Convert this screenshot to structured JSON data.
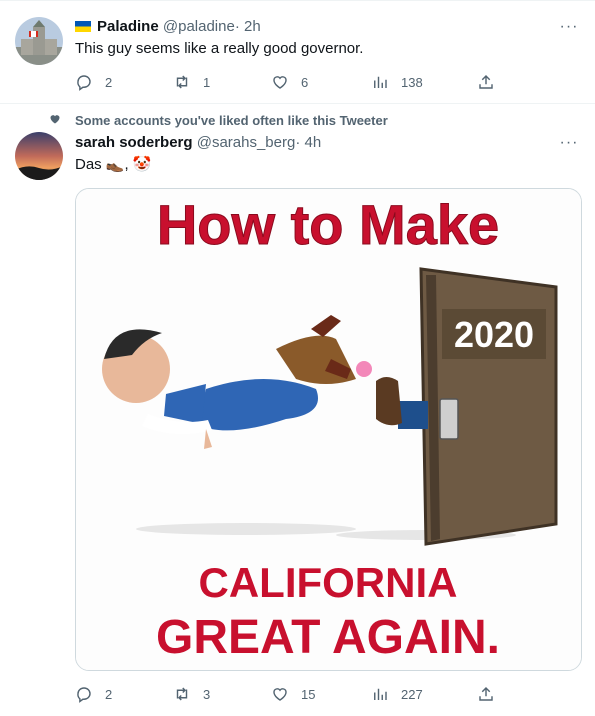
{
  "tweet1": {
    "display_name": "Paladine",
    "handle": "@paladine",
    "dot": "·",
    "time": "2h",
    "text": "This guy seems like a really good governor.",
    "more": "···",
    "replies": "2",
    "retweets": "1",
    "likes": "6",
    "views": "138"
  },
  "tweet2": {
    "social_context": "Some accounts you've liked often like this Tweeter",
    "display_name": "sarah soderberg",
    "handle": "@sarahs_berg",
    "dot": "·",
    "time": "4h",
    "text": "Das 👞, 🤡",
    "more": "···",
    "replies": "2",
    "retweets": "3",
    "likes": "15",
    "views": "227",
    "image": {
      "headline": "How to Make",
      "door_sign": "2020",
      "footer_line1": "CALIFORNIA",
      "footer_line2": "GREAT AGAIN."
    }
  },
  "icons": {
    "reply": "reply-icon",
    "retweet": "retweet-icon",
    "like": "heart-icon",
    "views": "views-icon",
    "share": "share-icon",
    "flag": "ukraine-flag-icon"
  },
  "colors": {
    "text": "#0f1419",
    "secondary": "#536471",
    "border": "#cfd9de",
    "headline_red": "#c8102e"
  }
}
